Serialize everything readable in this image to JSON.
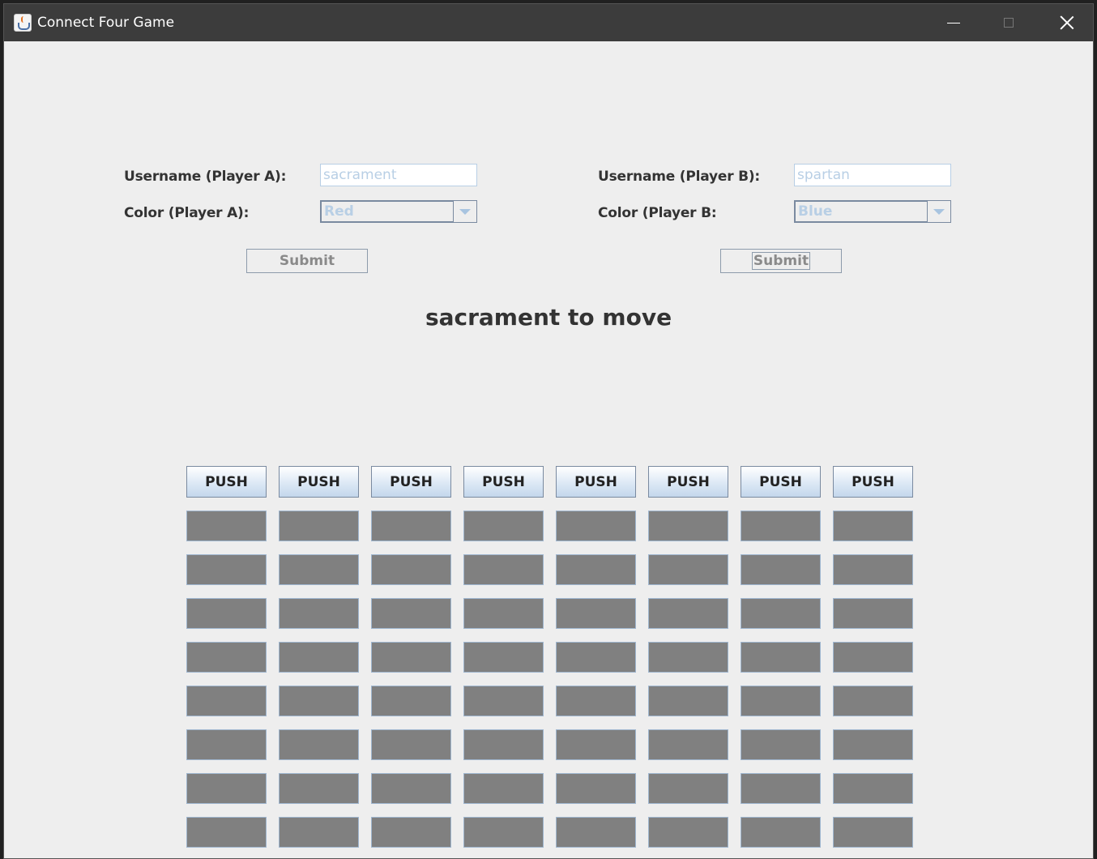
{
  "window": {
    "title": "Connect Four Game",
    "icon": "java-cup-icon"
  },
  "player_a": {
    "username_label": "Username (Player A):",
    "username_value": "sacrament",
    "color_label": "Color (Player A):",
    "color_value": "Red",
    "submit_label": "Submit"
  },
  "player_b": {
    "username_label": "Username (Player B):",
    "username_value": "spartan",
    "color_label": "Color (Player B:",
    "color_value": "Blue",
    "submit_label": "Submit"
  },
  "status_text": "sacrament to move",
  "board": {
    "columns": 8,
    "rows": 8,
    "push_label": "PUSH",
    "empty_color": "#808080"
  },
  "colors": {
    "titlebar": "#3c3c3c",
    "background": "#eeeeee",
    "disabled_text": "#b8cfe5"
  }
}
